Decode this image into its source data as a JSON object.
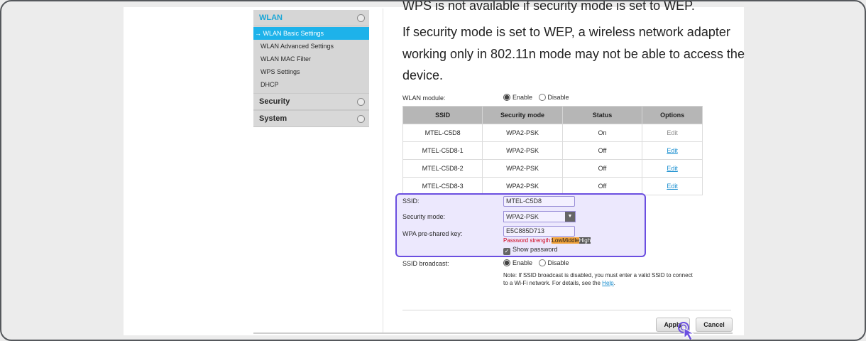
{
  "sidebar": {
    "wlan_title": "WLAN",
    "items": [
      {
        "label": "→ WLAN Basic Settings",
        "selected": true
      },
      {
        "label": "WLAN Advanced Settings",
        "selected": false
      },
      {
        "label": "WLAN MAC Filter",
        "selected": false
      },
      {
        "label": "WPS Settings",
        "selected": false
      },
      {
        "label": "DHCP",
        "selected": false
      }
    ],
    "security_title": "Security",
    "system_title": "System"
  },
  "info": {
    "cut_line": "WPS is not available if security mode is set to WEP.",
    "line1": "If security mode is set to WEP, a wireless network adapter",
    "line2": "working only in 802.11n mode may not be able to access the",
    "line3": "device."
  },
  "wlan_module": {
    "label": "WLAN module:",
    "enable": "Enable",
    "disable": "Disable",
    "value": "Enable"
  },
  "table": {
    "headers": [
      "SSID",
      "Security mode",
      "Status",
      "Options"
    ],
    "rows": [
      {
        "ssid": "MTEL-C5D8",
        "mode": "WPA2-PSK",
        "status": "On",
        "option": "Edit"
      },
      {
        "ssid": "MTEL-C5D8-1",
        "mode": "WPA2-PSK",
        "status": "Off",
        "option": "Edit"
      },
      {
        "ssid": "MTEL-C5D8-2",
        "mode": "WPA2-PSK",
        "status": "Off",
        "option": "Edit"
      },
      {
        "ssid": "MTEL-C5D8-3",
        "mode": "WPA2-PSK",
        "status": "Off",
        "option": "Edit"
      }
    ]
  },
  "form": {
    "ssid_label": "SSID:",
    "ssid_value": "MTEL-C5D8",
    "security_label": "Security mode:",
    "security_value": "WPA2-PSK",
    "key_label": "WPA pre-shared key:",
    "key_value": "E5C885D713",
    "strength_label": "Password strength:",
    "strength_low": "Low",
    "strength_mid": "Middle",
    "strength_high": "High",
    "show_password": "Show password",
    "broadcast_label": "SSID broadcast:",
    "broadcast_enable": "Enable",
    "broadcast_disable": "Disable",
    "note_text": "Note: If SSID broadcast is disabled, you must enter a valid SSID to connect to a Wi-Fi network. For details, see the",
    "note_link": "Help",
    "note_end": "."
  },
  "buttons": {
    "apply": "Apply",
    "cancel": "Cancel"
  },
  "colors": {
    "highlight_border": "#6b4fe0",
    "highlight_fill": "#ece8fd",
    "selected_item": "#1db2ea",
    "link": "#1a8fd0"
  }
}
